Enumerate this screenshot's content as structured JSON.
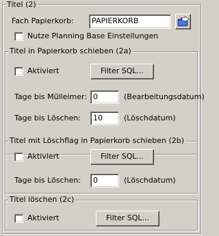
{
  "outer_group": {
    "title": "Titel (2)"
  },
  "fach_papierkorb": {
    "label": "Fach Papierkorb:",
    "value": "PAPIERKORB",
    "icon": "folder-arrow-icon"
  },
  "planning_base": {
    "label": "Nutze Planning Base Einstellungen",
    "checked": false
  },
  "group_2a": {
    "title": "Titel in Papierkorb schieben (2a)",
    "aktiviert_label": "Aktiviert",
    "aktiviert_checked": false,
    "filter_button": "Filter SQL...",
    "muelleimer_label": "Tage bis Mülleimer:",
    "muelleimer_value": "0",
    "muelleimer_hint": "(Bearbeitungsdatum)",
    "loeschen_label": "Tage bis Löschen:",
    "loeschen_value": "10",
    "loeschen_hint": "(Löschdatum)"
  },
  "group_2b": {
    "title": "Titel mit Löschflag in Papierkorb schieben (2b)",
    "aktiviert_label": "Aktiviert",
    "aktiviert_checked": false,
    "filter_button": "Filter SQL...",
    "loeschen_label": "Tage bis Löschen:",
    "loeschen_value": "0",
    "loeschen_hint": "(Löschdatum)"
  },
  "group_2c": {
    "title": "Titel löschen (2c)",
    "aktiviert_label": "Aktiviert",
    "aktiviert_checked": false,
    "filter_button": "Filter SQL..."
  },
  "colors": {
    "panel_bg": "#d4d0c8",
    "icon_blue": "#1f3fa8"
  }
}
